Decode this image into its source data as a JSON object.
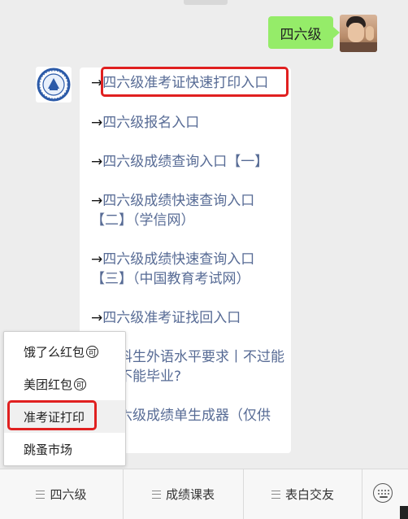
{
  "user_message": "四六级",
  "links": [
    "四六级准考证快速打印入口",
    "四六级报名入口",
    "四六级成绩查询入口【一】",
    "四六级成绩快速查询入口【二】（学信网）",
    "四六级成绩快速查询入口【三】（中国教育考试网）",
    "四六级准考证找回入口",
    "科生外语水平要求丨不过能不能毕业?",
    "六级成绩单生成器（仅供"
  ],
  "arrow": "→",
  "popup_menu": {
    "items": [
      "饿了么红包",
      "美团红包",
      "准考证打印",
      "跳蚤市场"
    ],
    "badge": "可",
    "selected": "准考证打印"
  },
  "bottom_menu": [
    "四六级",
    "成绩课表",
    "表白交友"
  ],
  "icons": {
    "keyboard": "keyboard-icon",
    "bot_avatar": "university-badge-icon",
    "user_avatar": "user-avatar-photo"
  },
  "colors": {
    "link": "#576b95",
    "user_bubble": "#95ec69",
    "highlight": "#e02020",
    "background": "#ededed"
  }
}
